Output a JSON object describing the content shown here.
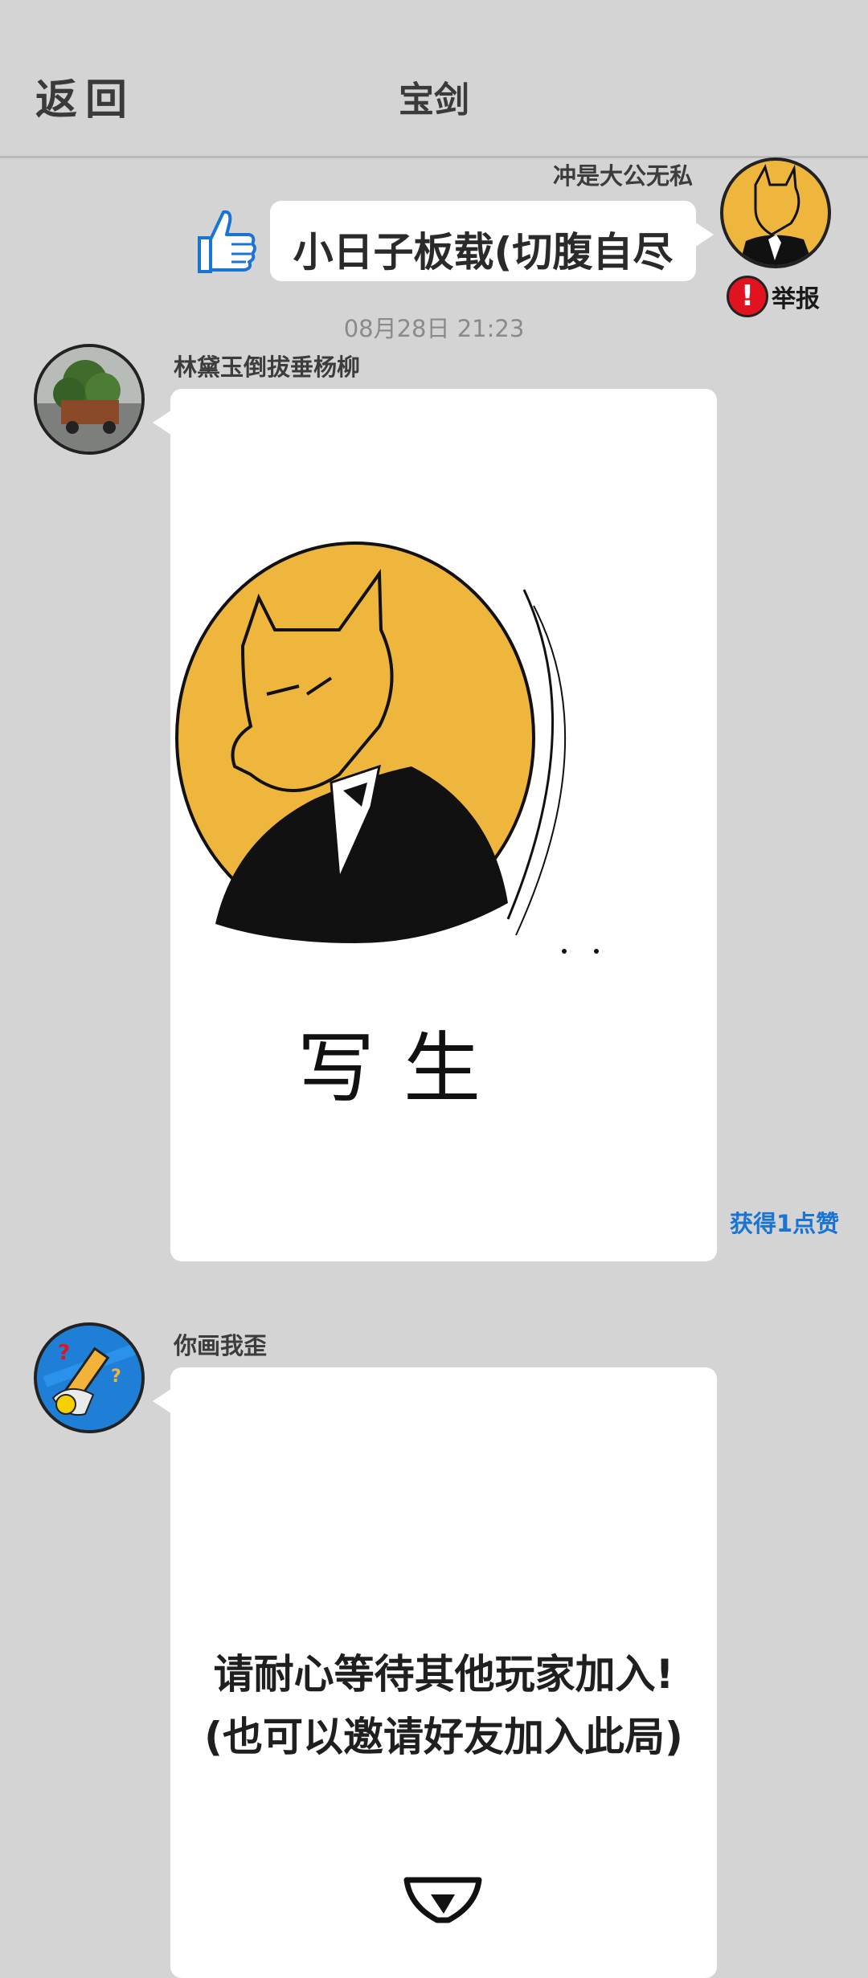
{
  "header": {
    "back_label": "返回",
    "title": "宝剑"
  },
  "messages": [
    {
      "sender": "冲是大公无私",
      "text": "小日子板载(切腹自尽",
      "side": "right",
      "report_label": "举报"
    },
    {
      "timestamp": "08月28日  21:23"
    },
    {
      "sender": "林黛玉倒拔垂杨柳",
      "side": "left",
      "drawing_caption": "写生",
      "likes": "获得1点赞"
    },
    {
      "sender": "你画我歪",
      "side": "left",
      "wait_line1": "请耐心等待其他玩家加入!",
      "wait_line2": "(也可以邀请好友加入此局)"
    }
  ],
  "colors": {
    "background": "#d4d4d4",
    "bubble": "#ffffff",
    "accent_blue": "#1a74d4",
    "report_red": "#e1131f",
    "fox_yellow": "#eeb63c"
  },
  "icons": [
    "back-icon",
    "thumbs-up-icon",
    "report-icon",
    "hourglass-icon"
  ]
}
